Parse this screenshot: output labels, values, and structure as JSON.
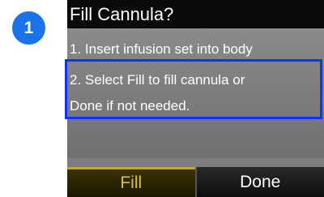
{
  "step": {
    "number": "1",
    "color": "#1a73e8"
  },
  "screen": {
    "title": "Fill Cannula?",
    "instruction_1": "1. Insert infusion set into body",
    "instruction_2_line_a": "2. Select Fill to fill cannula or",
    "instruction_2_line_b": "Done if not needed.",
    "highlight_color": "#1034f0"
  },
  "softkeys": {
    "left_label": "Fill",
    "left_color": "#d9c23a",
    "right_label": "Done"
  }
}
